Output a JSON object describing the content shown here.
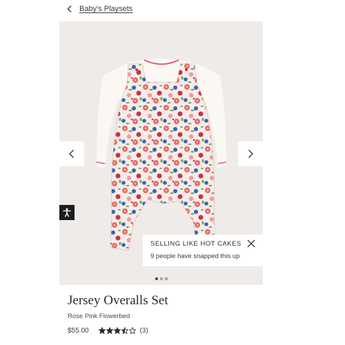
{
  "breadcrumb": {
    "label": "Baby's Playsets",
    "icon": "chevron-left-icon"
  },
  "gallery": {
    "image_alt": "Floral jersey overalls set with white long-sleeve top",
    "prev_icon": "chevron-left-icon",
    "next_icon": "chevron-right-icon",
    "slide_count": 3,
    "active_slide": 1,
    "background": "#eeebe8"
  },
  "accessibility": {
    "icon": "accessibility-icon"
  },
  "toast": {
    "title": "SELLING LIKE HOT CAKES",
    "message": "9 people have snapped this up",
    "close_icon": "close-icon"
  },
  "product": {
    "title": "Jersey Overalls Set",
    "color": "Rose Pink Flowerbed",
    "price": "$55.00",
    "rating": 3.5,
    "rating_max": 5,
    "review_count": "(3)"
  },
  "colors": {
    "floral_pink": "#e8697a",
    "floral_blue": "#3a62b8",
    "floral_red": "#c8324a",
    "floral_green": "#6fa56a",
    "star": "#2b2b2b"
  }
}
